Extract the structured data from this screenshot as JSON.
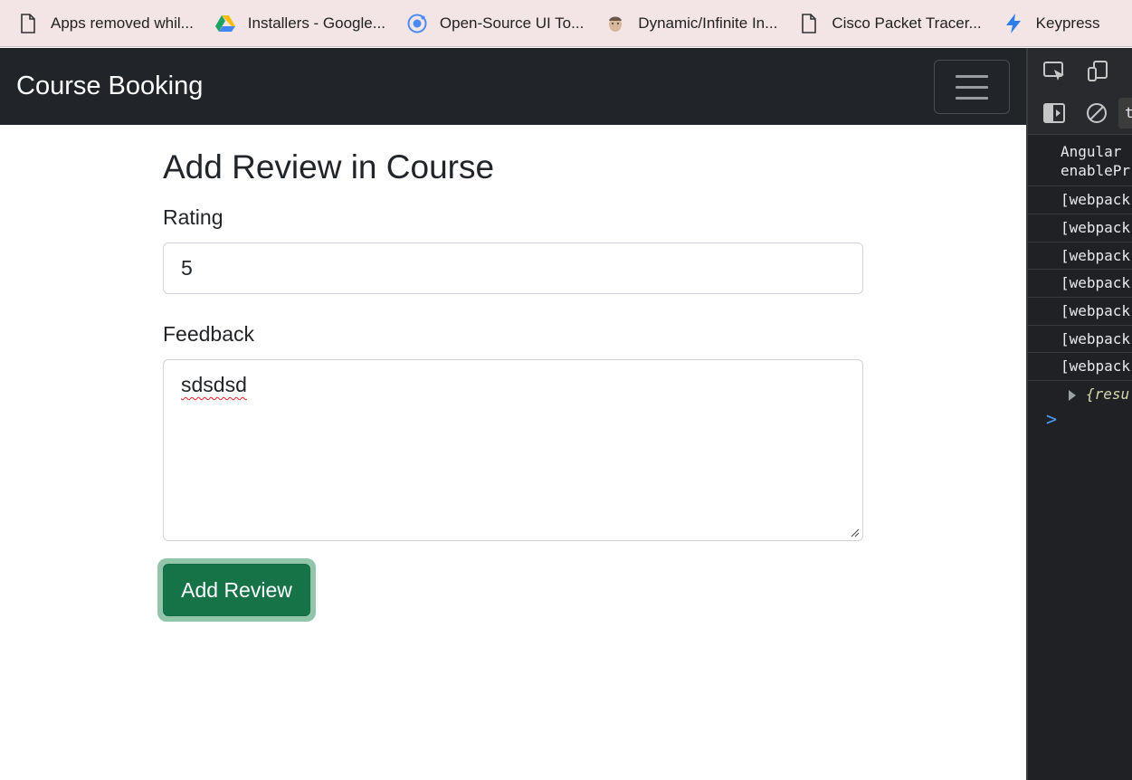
{
  "bookmarks": [
    {
      "label": "Apps removed whil...",
      "icon": "page-icon"
    },
    {
      "label": "Installers - Google...",
      "icon": "google-drive-icon"
    },
    {
      "label": "Open-Source UI To...",
      "icon": "ionic-icon"
    },
    {
      "label": "Dynamic/Infinite In...",
      "icon": "avatar-icon"
    },
    {
      "label": "Cisco Packet Tracer...",
      "icon": "page-icon"
    },
    {
      "label": "Keypress",
      "icon": "bolt-icon"
    }
  ],
  "navbar": {
    "brand": "Course Booking",
    "toggler_icon": "hamburger-icon",
    "background": "#212529"
  },
  "form": {
    "title": "Add Review in Course",
    "rating_label": "Rating",
    "rating_value": "5",
    "feedback_label": "Feedback",
    "feedback_value": "sdsdsd",
    "submit_label": "Add Review",
    "submit_color": "#157347"
  },
  "devtools": {
    "filter_text": "te",
    "logs": [
      "Angular is running in development mode. Call enableProdMode()",
      "[webpack",
      "[webpack",
      "[webpack",
      "[webpack",
      "[webpack",
      "[webpack",
      "[webpack"
    ],
    "logs_visible_first_line": "Angular",
    "logs_visible_second_line": "enablePr",
    "result_text": "{resu",
    "prompt": ">"
  }
}
